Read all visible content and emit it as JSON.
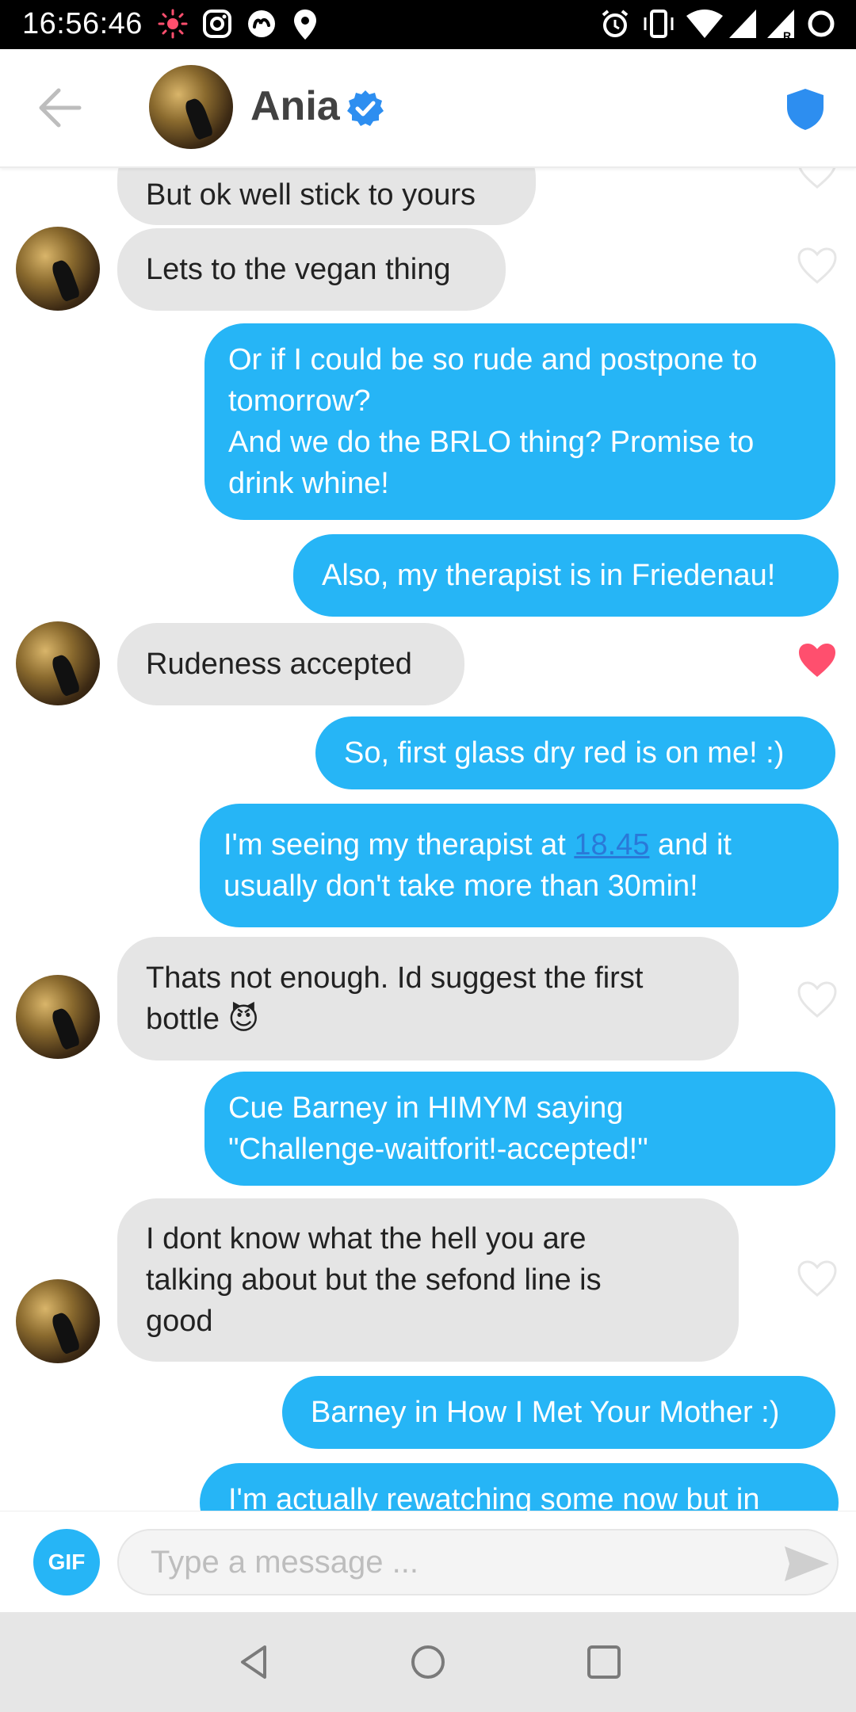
{
  "status_bar": {
    "time": "16:56:46",
    "left_icons": [
      "sun-notification-icon",
      "instagram-icon",
      "tinder-notification-icon",
      "location-icon"
    ],
    "right_icons": [
      "alarm-icon",
      "vibrate-icon",
      "wifi-icon",
      "cell-signal-icon",
      "cell-signal-roaming-icon",
      "battery-icon"
    ]
  },
  "header": {
    "contact_name": "Ania",
    "verified": true,
    "colors": {
      "accent": "#26b5f6",
      "shield": "#2d8ef0"
    }
  },
  "messages": [
    {
      "side": "in",
      "text": "But ok well stick to yours",
      "liked": false
    },
    {
      "side": "in",
      "text": "Lets to the vegan thing",
      "liked": false
    },
    {
      "side": "out",
      "text": "Or if I could be so rude and postpone to\ntomorrow?\nAnd we do the BRLO thing? Promise to\ndrink whine!"
    },
    {
      "side": "out",
      "text": "Also, my therapist is in Friedenau!"
    },
    {
      "side": "in",
      "text": "Rudeness accepted",
      "liked": true
    },
    {
      "side": "out",
      "text": "So, first glass dry red is on me! :)"
    },
    {
      "side": "out",
      "text_before": "I'm seeing my therapist at ",
      "link": "18.45",
      "text_after": " and it\nusually don't take more than 30min!"
    },
    {
      "side": "in",
      "text": "Thats not enough. Id suggest the first\nbottle",
      "emoji": "😈",
      "liked": false
    },
    {
      "side": "out",
      "text": "Cue Barney in HIMYM saying\n\"Challenge-waitforit!-accepted!\""
    },
    {
      "side": "in",
      "text": "I dont know what the hell you are\ntalking about but the sefond line is\ngood",
      "liked": false
    },
    {
      "side": "out",
      "text": "Barney in How I Met Your Mother :)"
    },
    {
      "side": "out",
      "text": "I'm actually rewatching some now but in"
    }
  ],
  "composer": {
    "gif_label": "GIF",
    "placeholder": "Type a message ..."
  },
  "nav": {
    "buttons": [
      "back-nav-icon",
      "home-nav-icon",
      "recents-nav-icon"
    ]
  }
}
